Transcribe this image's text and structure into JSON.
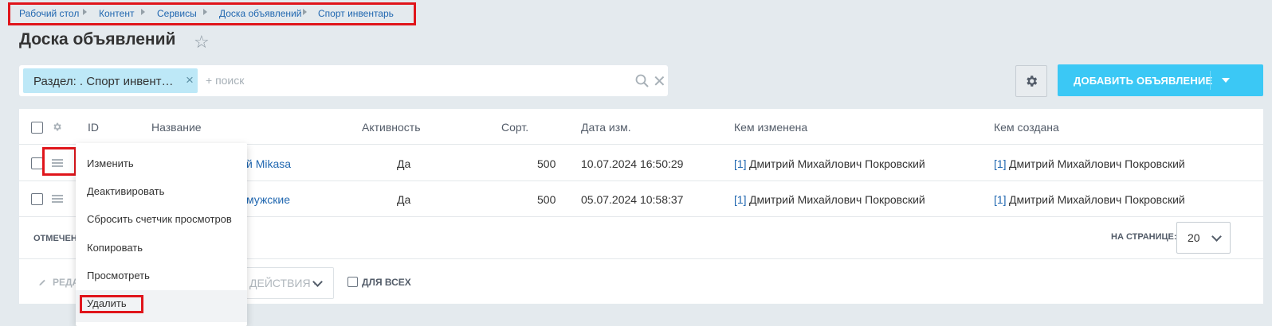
{
  "breadcrumbs": [
    "Рабочий стол",
    "Контент",
    "Сервисы",
    "Доска объявлений",
    "Спорт инвентарь"
  ],
  "page_title": "Доска объявлений",
  "filter": {
    "chip_label": "Раздел: . Спорт инвент…",
    "search_placeholder": "+ поиск"
  },
  "add_button_label": "ДОБАВИТЬ ОБЪЯВЛЕНИЕ",
  "columns": {
    "id": "ID",
    "name": "Название",
    "active": "Активность",
    "sort": "Сорт.",
    "date": "Дата изм.",
    "modified_by": "Кем изменена",
    "created_by": "Кем создана"
  },
  "rows": [
    {
      "name_visible": "й Mikasa",
      "active": "Да",
      "sort": "500",
      "date": "10.07.2024 16:50:29",
      "modified_id": "[1]",
      "modified_name": "Дмитрий Михайлович Покровский",
      "created_id": "[1]",
      "created_name": "Дмитрий Михайлович Покровский"
    },
    {
      "name_visible": "мужские",
      "active": "Да",
      "sort": "500",
      "date": "05.07.2024 10:58:37",
      "modified_id": "[1]",
      "modified_name": "Дмитрий Михайлович Покровский",
      "created_id": "[1]",
      "created_name": "Дмитрий Михайлович Покровский"
    }
  ],
  "footer": {
    "marked_label": "ОТМЕЧЕН",
    "per_page_label": "НА СТРАНИЦЕ:",
    "per_page_value": "20",
    "edit_label": "РЕДА",
    "actions_label": "ДЕЙСТВИЯ -",
    "for_all_label": "ДЛЯ ВСЕХ"
  },
  "context_menu": [
    "Изменить",
    "Деактивировать",
    "Сбросить счетчик просмотров",
    "Копировать",
    "Просмотреть",
    "Удалить"
  ],
  "colors": {
    "accent": "#3bc8f5",
    "link": "#2067b0",
    "highlight_box": "#e0151b",
    "chip": "#bde8f7",
    "background": "#e4eaee"
  },
  "icons": [
    "star-icon",
    "search-icon",
    "close-icon",
    "gear-icon",
    "chevron-down-icon",
    "menu-icon",
    "pencil-icon"
  ]
}
